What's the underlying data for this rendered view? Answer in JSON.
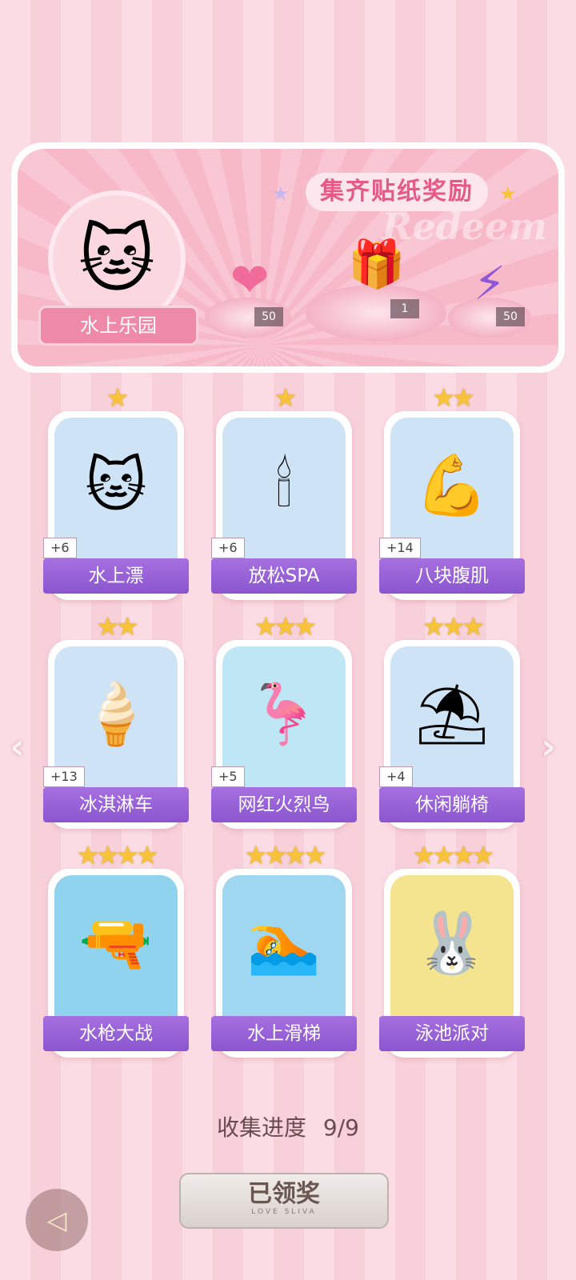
{
  "banner": {
    "title": "集齐贴纸奖励",
    "watermark": "Redeem",
    "theme_label": "水上乐园",
    "theme_icon": "cat-swim-ring-icon",
    "rewards": [
      {
        "icon": "pink-heart-gem-icon",
        "count": "50"
      },
      {
        "icon": "gift-box-icon",
        "count": "1"
      },
      {
        "icon": "purple-energy-orb-icon",
        "count": "50"
      }
    ]
  },
  "cards": [
    {
      "label": "水上漂",
      "plus": "+6",
      "stars": 1,
      "icon": "cat-swim-ring-icon",
      "bg": "#cfe3f7"
    },
    {
      "label": "放松SPA",
      "plus": "+6",
      "stars": 1,
      "icon": "candle-diffuser-icon",
      "bg": "#cfe3f7"
    },
    {
      "label": "八块腹肌",
      "plus": "+14",
      "stars": 2,
      "icon": "muscle-cat-icon",
      "bg": "#cfe3f7"
    },
    {
      "label": "冰淇淋车",
      "plus": "+13",
      "stars": 2,
      "icon": "ice-cream-truck-icon",
      "bg": "#cfe3f7"
    },
    {
      "label": "网红火烈鸟",
      "plus": "+5",
      "stars": 3,
      "icon": "flamingo-float-icon",
      "bg": "#bfe6f5"
    },
    {
      "label": "休闲躺椅",
      "plus": "+4",
      "stars": 3,
      "icon": "beach-chair-icon",
      "bg": "#cfe3f7"
    },
    {
      "label": "水枪大战",
      "plus": "",
      "stars": 4,
      "icon": "water-gun-boy-icon",
      "bg": "#8fd3ee"
    },
    {
      "label": "水上滑梯",
      "plus": "",
      "stars": 4,
      "icon": "water-slide-girl-icon",
      "bg": "#9fd6f0"
    },
    {
      "label": "泳池派对",
      "plus": "",
      "stars": 4,
      "icon": "pool-party-bunny-icon",
      "bg": "#f5e48f"
    }
  ],
  "progress": {
    "label": "收集进度",
    "value": "9/9"
  },
  "claim_button": {
    "label": "已领奖",
    "sub": "LOVE SLIVA"
  }
}
